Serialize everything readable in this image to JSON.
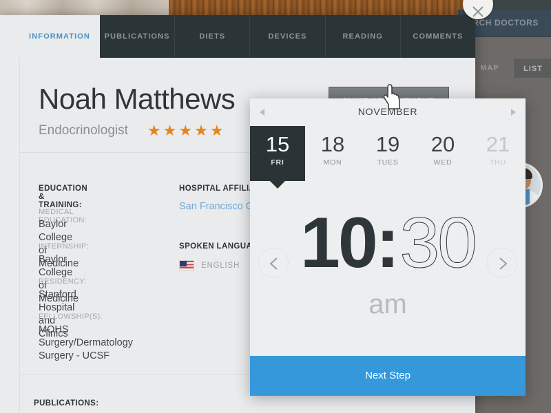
{
  "background_page": {
    "search_label": "ARCH DOCTORS",
    "map_tab": "MAP",
    "list_tab": "LIST",
    "avatar_name": "doctor-avatar",
    "close_icon": "close-icon"
  },
  "profile": {
    "tabs": [
      {
        "label": "INFORMATION",
        "active": true
      },
      {
        "label": "PUBLICATIONS",
        "active": false
      },
      {
        "label": "DIETS",
        "active": false
      },
      {
        "label": "DEVICES",
        "active": false
      },
      {
        "label": "READING",
        "active": false
      },
      {
        "label": "COMMENTS",
        "active": false
      }
    ],
    "doctor_name": "Noah Matthews",
    "specialty": "Endocrinologist",
    "rating_stars": "★★★★★",
    "rating_value": 5,
    "make_appointment_label": "MAKE APPOINTMENT",
    "education": {
      "heading": "EDUCATION & TRAINING:",
      "entries": [
        {
          "label": "MEDICAL EDUCATION:",
          "value": "Baylor College of Medicine"
        },
        {
          "label": "INTERNSHIP:",
          "value": "Baylor College of Medicine"
        },
        {
          "label": "RESIDENCY:",
          "value": "Stanford Hospital and Clinics"
        },
        {
          "label": "FELLOWSHIP(S):",
          "value": "MOHS Surgery/Dermatology\nSurgery - UCSF"
        }
      ]
    },
    "hospital": {
      "heading": "HOSPITAL AFFILIAT",
      "link": "San Francisco Ger"
    },
    "languages": {
      "heading": "SPOKEN LANGUAG",
      "flag_icon": "us-flag-icon",
      "label": "ENGLISH"
    },
    "publications_heading": "PUBLICATIONS:"
  },
  "picker": {
    "month": "NOVEMBER",
    "prev_icon": "triangle-left-icon",
    "next_icon": "triangle-right-icon",
    "dates": [
      {
        "day": "15",
        "dow": "FRI",
        "selected": true,
        "dim": false
      },
      {
        "day": "18",
        "dow": "MON",
        "selected": false,
        "dim": false
      },
      {
        "day": "19",
        "dow": "TUES",
        "selected": false,
        "dim": false
      },
      {
        "day": "20",
        "dow": "WED",
        "selected": false,
        "dim": false
      },
      {
        "day": "21",
        "dow": "THU",
        "selected": false,
        "dim": true
      }
    ],
    "time": {
      "hour": "10",
      "colon": ":",
      "minute": "30",
      "meridiem": "am",
      "prev_icon": "chevron-left-icon",
      "next_icon": "chevron-right-icon"
    },
    "next_step_label": "Next Step"
  },
  "colors": {
    "accent_blue": "#3498db",
    "link_blue": "#6fa8d8",
    "tab_active_blue": "#4a90c4",
    "dark_slate": "#2b3436",
    "star_orange": "#e8841a",
    "card_bg": "#e9ebec",
    "picker_bg": "#eceeef"
  },
  "cursor": {
    "icon": "pointing-hand-cursor"
  }
}
